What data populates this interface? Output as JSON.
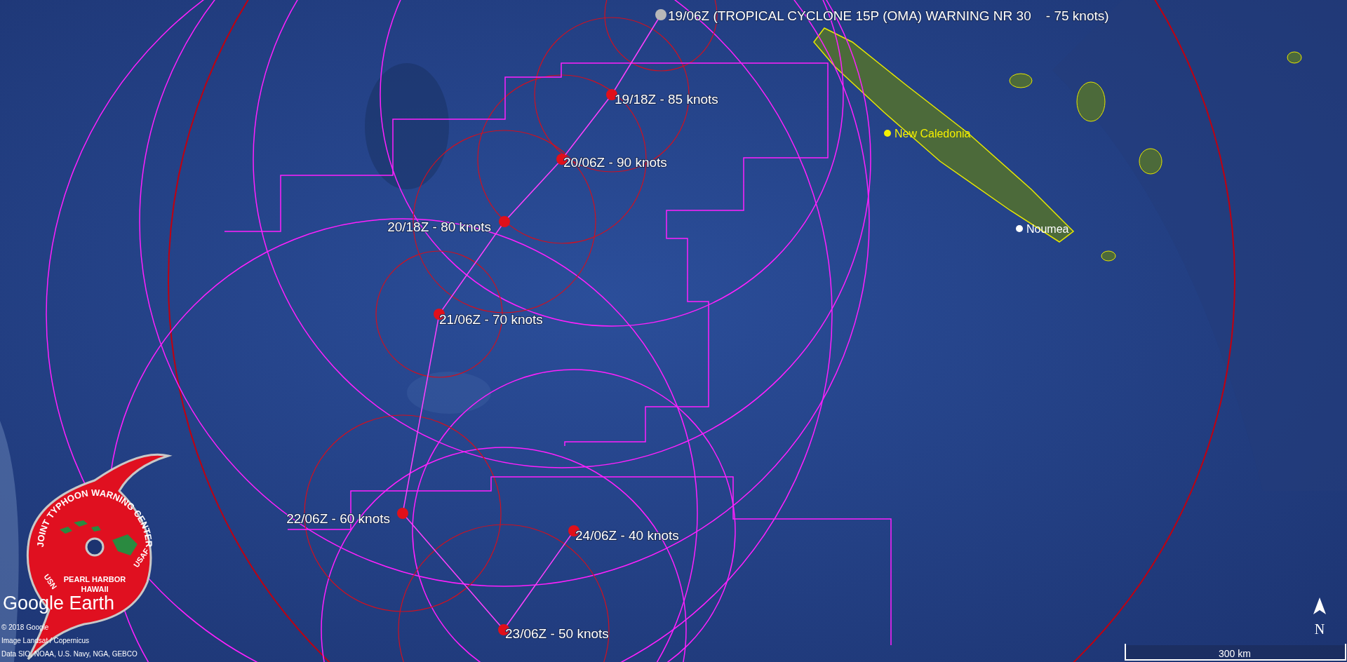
{
  "track": [
    {
      "label": "19/06Z (TROPICAL CYCLONE 15P (OMA) WARNING NR 30    - 75 knots)",
      "kind": "current"
    },
    {
      "label": "19/18Z - 85 knots",
      "kind": "forecast"
    },
    {
      "label": "20/06Z - 90 knots",
      "kind": "forecast"
    },
    {
      "label": "20/18Z - 80 knots",
      "kind": "forecast"
    },
    {
      "label": "21/06Z - 70 knots",
      "kind": "forecast"
    },
    {
      "label": "22/06Z - 60 knots",
      "kind": "forecast"
    },
    {
      "label": "23/06Z - 50 knots",
      "kind": "forecast"
    },
    {
      "label": "24/06Z - 40 knots",
      "kind": "forecast"
    }
  ],
  "places": [
    {
      "name": "New Caledonia",
      "kind": "region"
    },
    {
      "name": "Noumea",
      "kind": "city"
    }
  ],
  "logo": {
    "ring_text": "JOINT TYPHOON WARNING CENTER",
    "left_text": "USN",
    "right_text": "USAF",
    "location": [
      "PEARL HARBOR",
      "HAWAII"
    ]
  },
  "brand": "Google Earth",
  "credits": [
    "© 2018 Google",
    "Image Landsat / Copernicus",
    "Data SIO, NOAA, U.S. Navy, NGA, GEBCO"
  ],
  "scale": "300 km",
  "compass": "N"
}
